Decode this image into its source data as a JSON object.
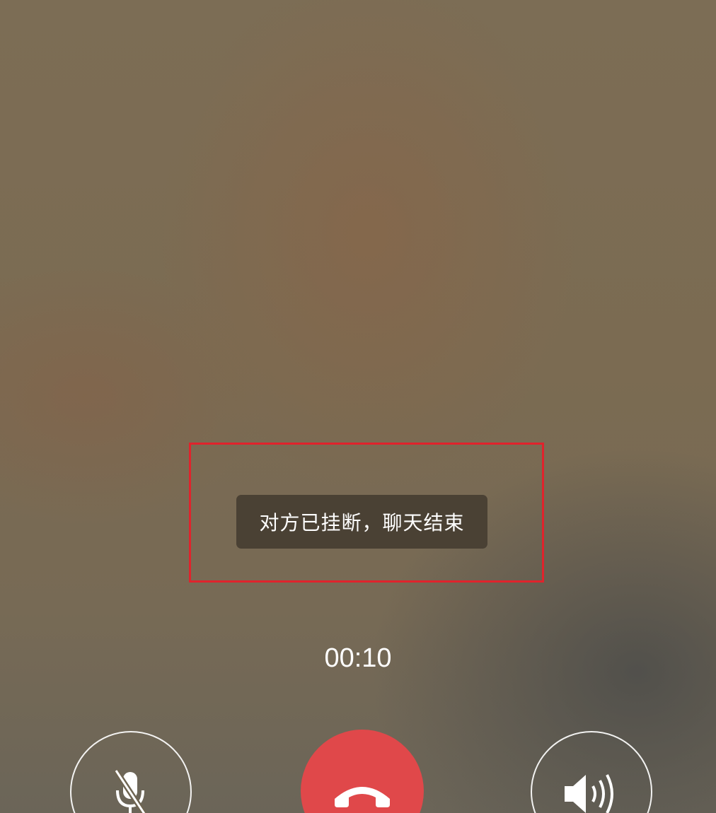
{
  "call": {
    "toast_message": "对方已挂断，聊天结束",
    "duration": "00:10"
  },
  "controls": {
    "mute_icon": "microphone-muted-icon",
    "hangup_icon": "phone-hangup-icon",
    "speaker_icon": "speaker-icon"
  },
  "colors": {
    "hangup": "#e0484a",
    "highlight": "#e0232c"
  }
}
